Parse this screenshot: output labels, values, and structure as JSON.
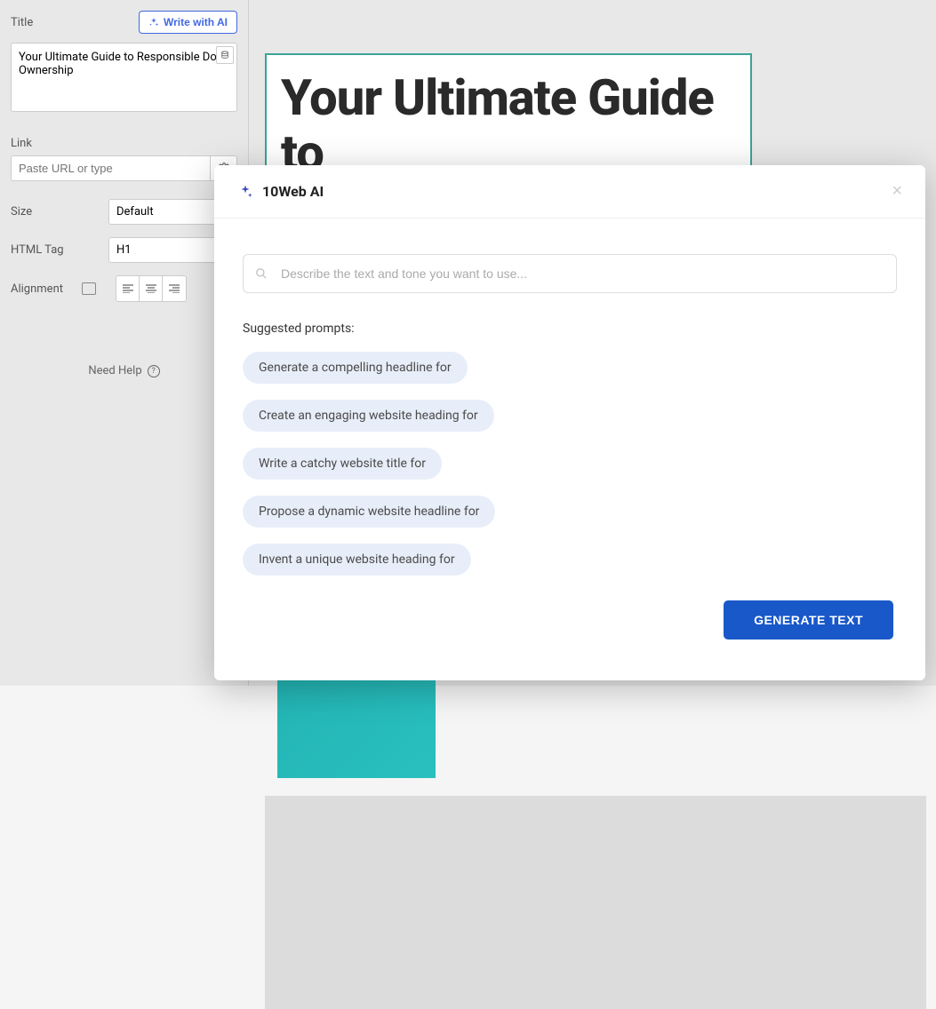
{
  "sidebar": {
    "title_label": "Title",
    "write_ai_label": "Write with AI",
    "title_value": "Your Ultimate Guide to Responsible Dog Ownership",
    "link_label": "Link",
    "link_placeholder": "Paste URL or type",
    "size_label": "Size",
    "size_value": "Default",
    "html_tag_label": "HTML Tag",
    "html_tag_value": "H1",
    "alignment_label": "Alignment",
    "need_help_label": "Need Help"
  },
  "canvas": {
    "headline": "Your Ultimate Guide to"
  },
  "modal": {
    "title": "10Web AI",
    "input_placeholder": "Describe the text and tone you want to use...",
    "suggested_label": "Suggested prompts:",
    "prompts": [
      "Generate a compelling headline for",
      "Create an engaging website heading for",
      "Write a catchy website title for",
      "Propose a dynamic website headline for",
      "Invent a unique website heading for"
    ],
    "generate_label": "GENERATE TEXT"
  }
}
